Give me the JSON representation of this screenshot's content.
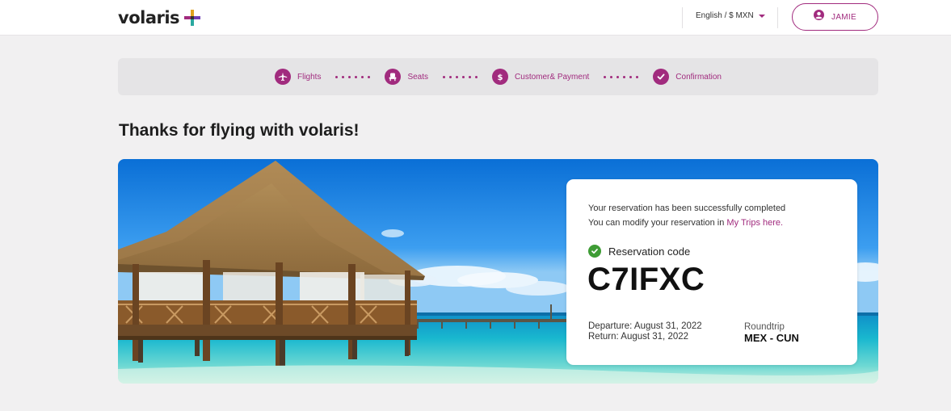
{
  "header": {
    "logo_text": "volaris",
    "language_currency": "English / $ MXN",
    "user_name": "JAMIE"
  },
  "stepper": {
    "steps": [
      {
        "label": "Flights",
        "icon": "plane-icon"
      },
      {
        "label": "Seats",
        "icon": "seat-icon"
      },
      {
        "label": "Customer& Payment",
        "icon": "dollar-icon"
      },
      {
        "label": "Confirmation",
        "icon": "check-icon"
      }
    ]
  },
  "main": {
    "title": "Thanks for flying with volaris!"
  },
  "confirmation": {
    "message_line1": "Your reservation has been successfully completed",
    "message_line2_prefix": "You can modify your reservation in ",
    "message_link": "My Trips here.",
    "code_label": "Reservation code",
    "code": "C7IFXC",
    "departure": "Departure: August 31, 2022",
    "return": "Return: August 31, 2022",
    "trip_type": "Roundtrip",
    "route": "MEX - CUN"
  },
  "colors": {
    "brand": "#a12b7e",
    "success": "#3e9c35",
    "page_bg": "#f1f0f1"
  }
}
